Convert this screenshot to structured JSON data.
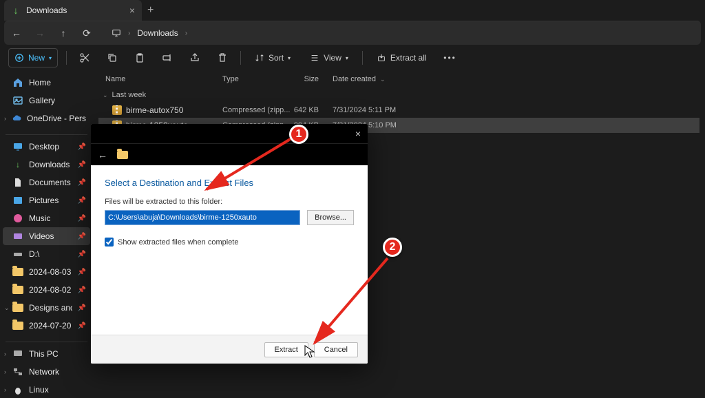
{
  "titlebar": {
    "tab_title": "Downloads"
  },
  "navbar": {
    "breadcrumb": "Downloads"
  },
  "toolbar": {
    "new_label": "New",
    "sort_label": "Sort",
    "view_label": "View",
    "extract_label": "Extract all"
  },
  "columns": {
    "name": "Name",
    "type": "Type",
    "size": "Size",
    "date": "Date created"
  },
  "groups": [
    {
      "label": "Last week"
    }
  ],
  "files": [
    {
      "name": "birme-autox750",
      "type": "Compressed (zipp...",
      "size": "642 KB",
      "date": "7/31/2024 5:11 PM"
    },
    {
      "name": "birme-1250xauto",
      "type": "Compressed (zipp...",
      "size": "994 KB",
      "date": "7/31/2024 5:10 PM"
    }
  ],
  "sidebar": {
    "home": "Home",
    "gallery": "Gallery",
    "onedrive": "OneDrive - Persona",
    "quick": [
      "Desktop",
      "Downloads",
      "Documents",
      "Pictures",
      "Music",
      "Videos",
      "D:\\",
      "2024-08-03",
      "2024-08-02",
      "Designs and Do",
      "2024-07-20"
    ],
    "system": [
      "This PC",
      "Network",
      "Linux"
    ]
  },
  "dialog": {
    "title": "Select a Destination and Extract Files",
    "subtitle": "Files will be extracted to this folder:",
    "path": "C:\\Users\\abuja\\Downloads\\birme-1250xauto",
    "browse": "Browse...",
    "checkbox": "Show extracted files when complete",
    "extract": "Extract",
    "cancel": "Cancel"
  },
  "annotations": {
    "badge1": "1",
    "badge2": "2"
  }
}
